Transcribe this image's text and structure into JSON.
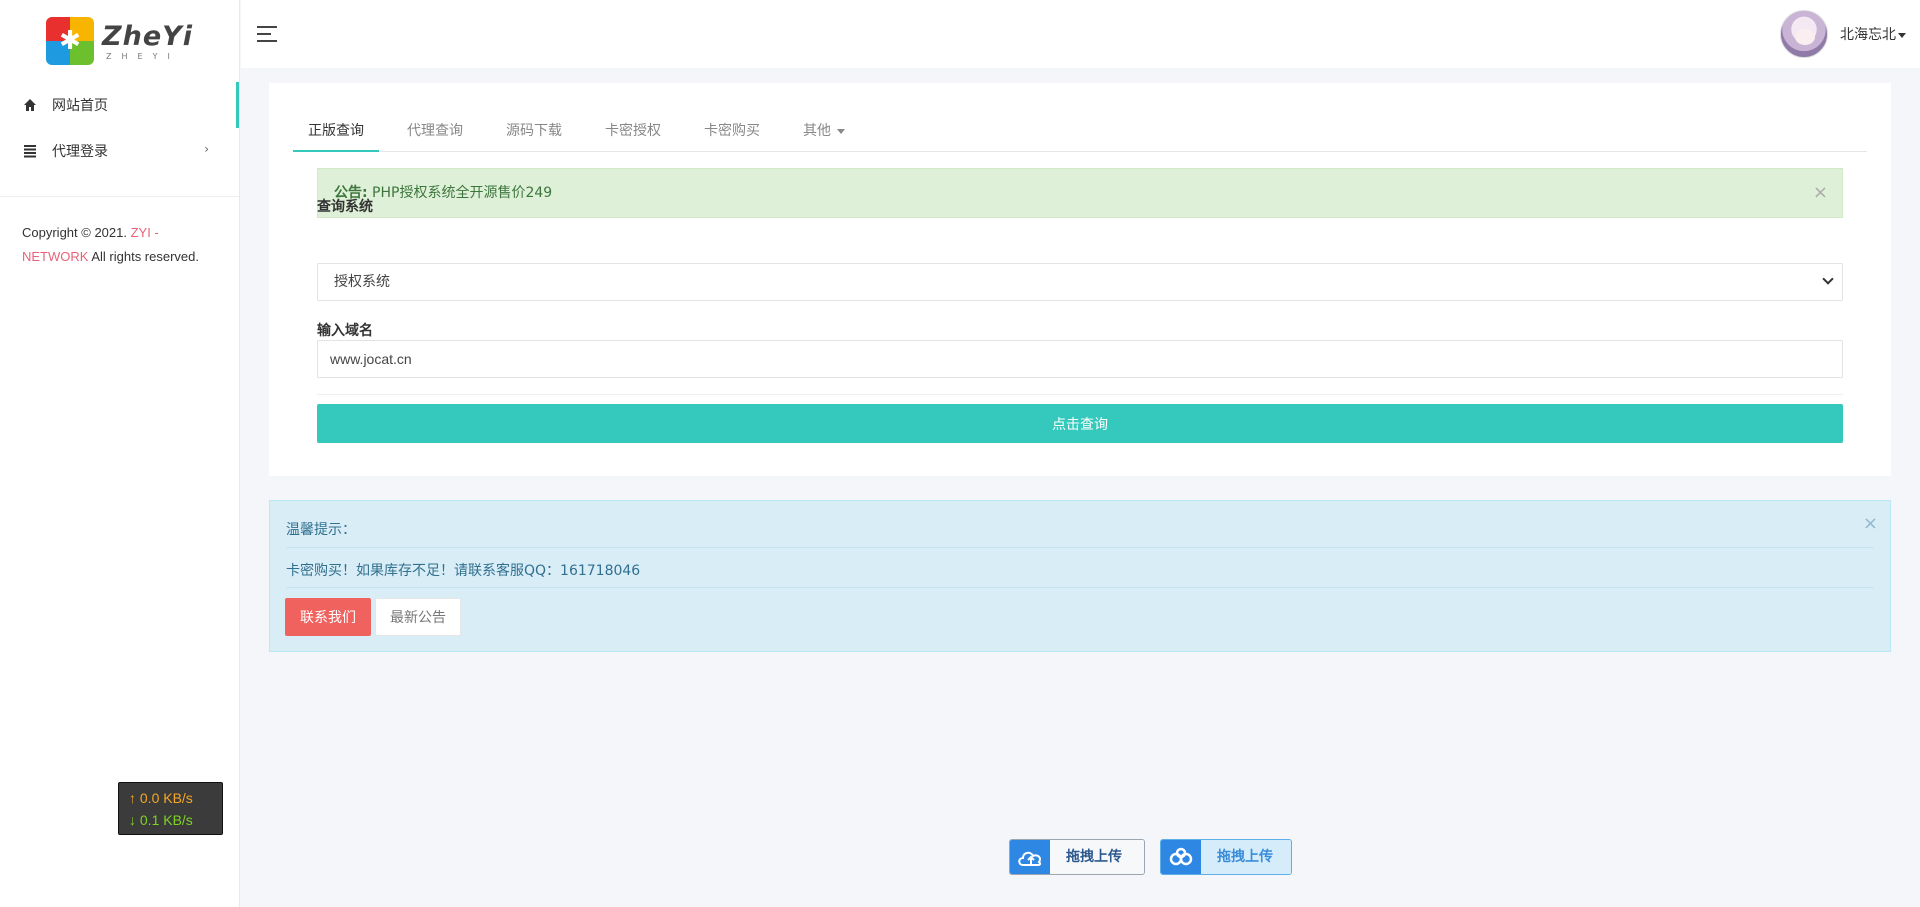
{
  "brand": {
    "name": "ZheYi",
    "sub": "ZHEYI"
  },
  "sidebar": {
    "items": [
      {
        "label": "网站首页",
        "icon": "home-icon"
      },
      {
        "label": "代理登录",
        "icon": "list-icon"
      }
    ],
    "copyright_prefix": "Copyright © 2021. ",
    "copyright_brand": "ZYI - NETWORK",
    "copyright_suffix": " All rights reserved."
  },
  "speed": {
    "up": "0.0 KB/s",
    "down": "0.1 KB/s"
  },
  "header": {
    "username": "北海忘北"
  },
  "tabs": [
    {
      "label": "正版查询"
    },
    {
      "label": "代理查询"
    },
    {
      "label": "源码下载"
    },
    {
      "label": "卡密授权"
    },
    {
      "label": "卡密购买"
    },
    {
      "label": "其他"
    }
  ],
  "notice": {
    "prefix": "公告:",
    "text": " PHP授权系统全开源售价249"
  },
  "form": {
    "system_label": "查询系统",
    "system_value": "授权系统",
    "domain_label": "输入域名",
    "domain_value": "www.jocat.cn",
    "submit_label": "点击查询"
  },
  "info": {
    "title": "温馨提示：",
    "message": "卡密购买！如果库存不足！请联系客服QQ：161718046",
    "contact_label": "联系我们",
    "news_label": "最新公告"
  },
  "upload": {
    "button1": "拖拽上传",
    "button2": "拖拽上传"
  },
  "colors": {
    "accent": "#34c9bc",
    "danger": "#f0625e",
    "success_bg": "#dff0d8",
    "info_bg": "#d9edf7",
    "brand_link": "#e8637a"
  }
}
